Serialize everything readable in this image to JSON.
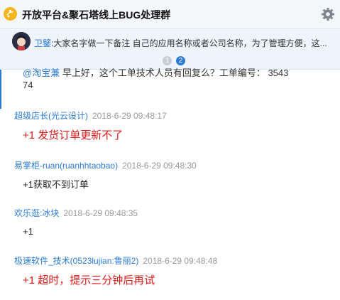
{
  "header": {
    "title": "开放平台&聚石塔线上BUG处理群",
    "icon": "group-icon",
    "settings_icon": "gear-icon"
  },
  "notice": {
    "sender": "卫鐾",
    "text": ":大家名字做一下备注 自己的应用名称或者公司名称，为了管理方便，这...",
    "pages": [
      "1",
      "2"
    ],
    "active_page": "2"
  },
  "partial_message": {
    "mention": "@淘宝兼",
    "line1": "早上好，这个工单技术人员有回复么？工单编号： 3543",
    "line2": "74"
  },
  "messages": [
    {
      "sender": "超级店长(光云设计)",
      "time": "2018-6-29 09:48:17",
      "content": "+1 发货订单更新不了",
      "style": "red"
    },
    {
      "sender": "易掌柜-ruan(ruanhhtaobao)",
      "time": "2018-6-29 09:48:30",
      "content": "+1获取不到订单",
      "style": "black"
    },
    {
      "sender": "欢乐逛:冰块",
      "time": "2018-6-29 09:48:35",
      "content": "+1",
      "style": "black"
    },
    {
      "sender": "极速软件_技术(0523lujian:鲁丽2)",
      "time": "2018-6-29 09:48:48",
      "content": "+1    超时，提示三分钟后再试",
      "style": "red"
    }
  ],
  "colors": {
    "accent": "#2b7bd6",
    "alert": "#e01818",
    "icon": "#f5b51c"
  }
}
